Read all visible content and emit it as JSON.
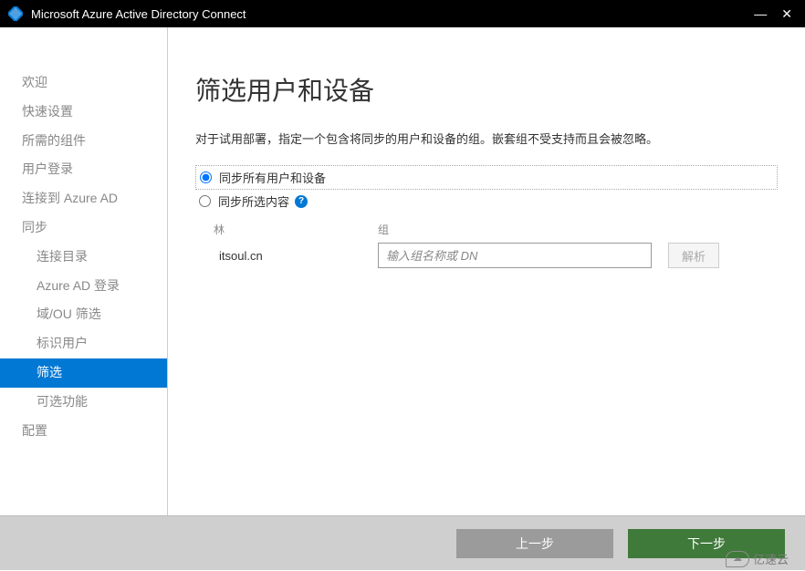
{
  "window": {
    "title": "Microsoft Azure Active Directory Connect"
  },
  "sidebar": {
    "items": [
      {
        "label": "欢迎",
        "level": 0,
        "active": false,
        "enabled": false
      },
      {
        "label": "快速设置",
        "level": 0,
        "active": false,
        "enabled": false
      },
      {
        "label": "所需的组件",
        "level": 0,
        "active": false,
        "enabled": false
      },
      {
        "label": "用户登录",
        "level": 0,
        "active": false,
        "enabled": false
      },
      {
        "label": "连接到 Azure AD",
        "level": 0,
        "active": false,
        "enabled": false
      },
      {
        "label": "同步",
        "level": 0,
        "active": false,
        "enabled": false
      },
      {
        "label": "连接目录",
        "level": 1,
        "active": false,
        "enabled": false
      },
      {
        "label": "Azure AD 登录",
        "level": 1,
        "active": false,
        "enabled": false
      },
      {
        "label": "域/OU 筛选",
        "level": 1,
        "active": false,
        "enabled": false
      },
      {
        "label": "标识用户",
        "level": 1,
        "active": false,
        "enabled": false
      },
      {
        "label": "筛选",
        "level": 1,
        "active": true,
        "enabled": true
      },
      {
        "label": "可选功能",
        "level": 1,
        "active": false,
        "enabled": false
      },
      {
        "label": "配置",
        "level": 0,
        "active": false,
        "enabled": false
      }
    ]
  },
  "content": {
    "title": "筛选用户和设备",
    "description": "对于试用部署，指定一个包含将同步的用户和设备的组。嵌套组不受支持而且会被忽略。",
    "radio_all": "同步所有用户和设备",
    "radio_selected": "同步所选内容",
    "forest_label": "林",
    "group_label": "组",
    "forest_value": "itsoul.cn",
    "group_placeholder": "输入组名称或 DN",
    "resolve_label": "解析"
  },
  "footer": {
    "prev_label": "上一步",
    "next_label": "下一步"
  },
  "watermark": {
    "text": "亿速云"
  }
}
